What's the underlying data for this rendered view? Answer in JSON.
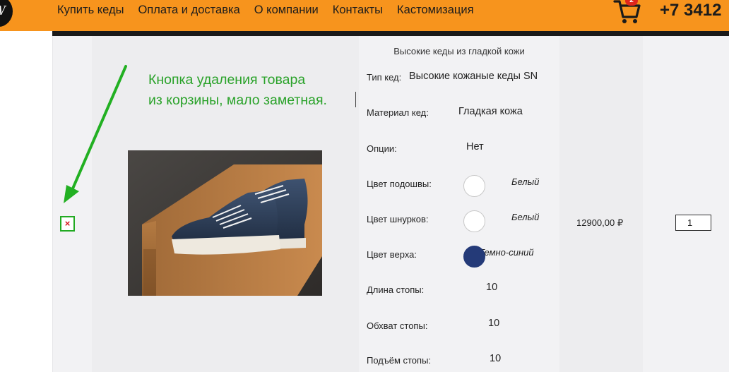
{
  "header": {
    "logo_text": "W",
    "nav": [
      "Купить кеды",
      "Оплата и доставка",
      "О компании",
      "Контакты",
      "Кастомизация"
    ],
    "cart_count": "2",
    "phone": "+7 3412"
  },
  "annotation": {
    "line1": "Кнопка удаления товара",
    "line2": "из корзины, мало заметная."
  },
  "cart_item": {
    "delete_label": "×",
    "title": "Высокие кеды из гладкой кожи",
    "image_alt": "sneakers-photo",
    "details": {
      "type_label": "Тип кед:",
      "type_value": "Высокие кожаные кеды SN",
      "material_label": "Материал кед:",
      "material_value": "Гладкая кожа",
      "options_label": "Опции:",
      "options_value": "Нет",
      "sole_color_label": "Цвет подошвы:",
      "sole_color_value": "Белый",
      "laces_color_label": "Цвет шнурков:",
      "laces_color_value": "Белый",
      "upper_color_label": "Цвет верха:",
      "upper_color_value": "Темно-синий",
      "foot_length_label": "Длина стопы:",
      "foot_length_value": "10",
      "foot_girth_label": "Обхват стопы:",
      "foot_girth_value": "10",
      "instep_label": "Подъём стопы:",
      "instep_value": "10"
    },
    "price": "12900,00 ₽",
    "quantity": "1"
  },
  "colors": {
    "header_bg": "#f7941d",
    "annotation": "#2aa22a",
    "delete_icon": "#d8101a",
    "sole_swatch": "#ffffff",
    "laces_swatch": "#ffffff",
    "upper_swatch": "#243a78"
  }
}
